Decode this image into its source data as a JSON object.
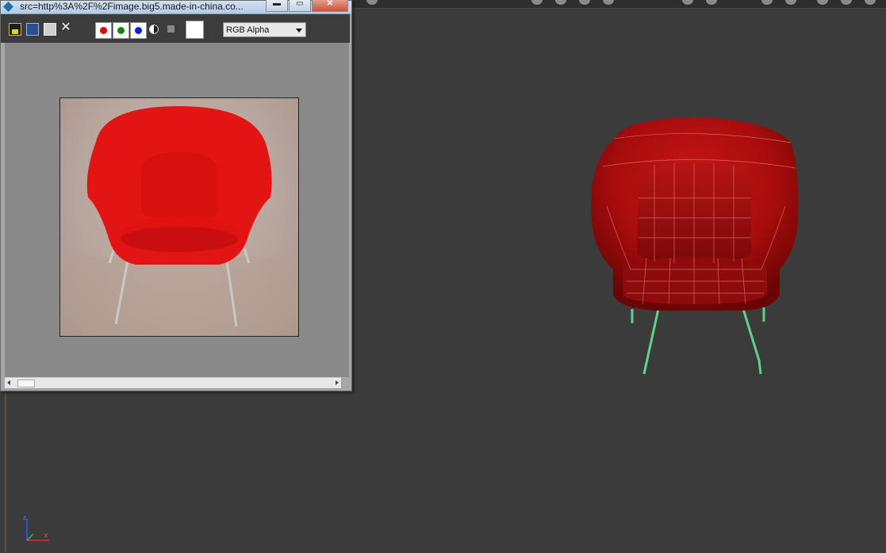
{
  "window": {
    "title": "src=http%3A%2F%2Fimage.big5.made-in-china.co...",
    "close_label": "✕",
    "minimize_label": "▬",
    "restore_label": "▭"
  },
  "toolbar": {
    "channel_select": "RGB Alpha",
    "icons": [
      "save-icon",
      "copy-icon",
      "print-icon",
      "clear-icon",
      "red-channel-icon",
      "green-channel-icon",
      "blue-channel-icon",
      "monochrome-icon",
      "alpha-icon",
      "color-swatch"
    ]
  },
  "colors": {
    "viewport": "#3b3b3b",
    "chair_red": "#d01010",
    "wire_green": "#5fd38a",
    "frame_bg": "#898989"
  },
  "axis": {
    "z": "z",
    "x": "x"
  }
}
